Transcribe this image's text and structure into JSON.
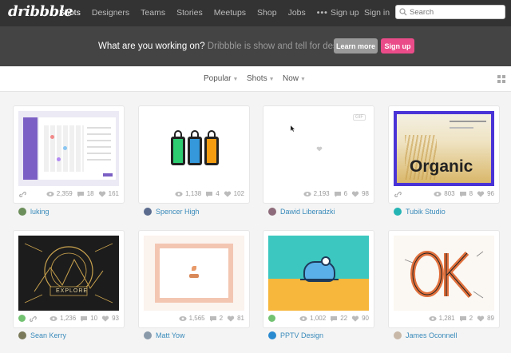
{
  "header": {
    "logo": "dribbble",
    "nav": [
      {
        "label": "Shots",
        "active": true
      },
      {
        "label": "Designers"
      },
      {
        "label": "Teams"
      },
      {
        "label": "Stories"
      },
      {
        "label": "Meetups"
      },
      {
        "label": "Shop"
      },
      {
        "label": "Jobs"
      }
    ],
    "more": "•••",
    "sign_up": "Sign up",
    "sign_in": "Sign in",
    "search_placeholder": "Search"
  },
  "banner": {
    "question": "What are you working on?",
    "tagline": " Dribbble is show and tell for designers.",
    "learn_more": "Learn more",
    "sign_up": "Sign up"
  },
  "filters": {
    "popular": "Popular",
    "shots": "Shots",
    "now": "Now"
  },
  "shots": [
    {
      "views": "2,359",
      "comments": "18",
      "likes": "161",
      "author": "luking",
      "avatar_color": "#6b8e5a",
      "has_link": true,
      "thumb": "calendar"
    },
    {
      "views": "1,138",
      "comments": "4",
      "likes": "102",
      "author": "Spencer High",
      "avatar_color": "#5a6b8e",
      "thumb": "bags"
    },
    {
      "views": "2,193",
      "comments": "6",
      "likes": "98",
      "author": "Dawid Liberadzki",
      "avatar_color": "#8e6b7a",
      "thumb": "gif",
      "gif_label": "GIF"
    },
    {
      "views": "803",
      "comments": "8",
      "likes": "96",
      "author": "Tubik Studio",
      "avatar_color": "#24b4b4",
      "has_link": true,
      "thumb": "organic",
      "organic_text": "Organic"
    },
    {
      "views": "1,236",
      "comments": "10",
      "likes": "93",
      "author": "Sean Kerry",
      "avatar_color": "#7a7a5a",
      "has_gif": true,
      "has_link": true,
      "thumb": "explore",
      "explore_text": "EXPLORE"
    },
    {
      "views": "1,565",
      "comments": "2",
      "likes": "81",
      "author": "Matt Yow",
      "avatar_color": "#8a9aaa",
      "thumb": "frame"
    },
    {
      "views": "1,002",
      "comments": "22",
      "likes": "90",
      "author": "PPTV Design",
      "avatar_color": "#2a8ad0",
      "has_gif": true,
      "thumb": "hippo"
    },
    {
      "views": "1,281",
      "comments": "2",
      "likes": "89",
      "author": "James Oconnell",
      "avatar_color": "#c8b8a8",
      "thumb": "ok"
    }
  ]
}
